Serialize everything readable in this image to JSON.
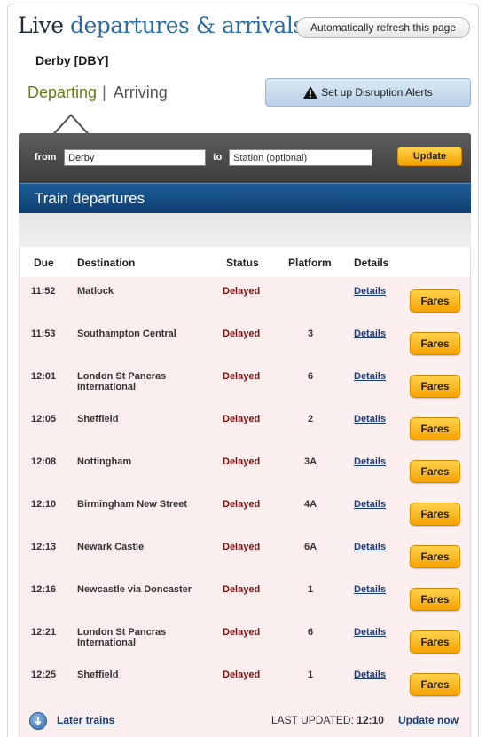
{
  "header": {
    "title_part1": "Live",
    "title_part2": "departures & arrivals",
    "refresh_label": "Automatically refresh this page"
  },
  "station": "Derby [DBY]",
  "tabs": {
    "departing": "Departing",
    "separator": "|",
    "arriving": "Arriving"
  },
  "alerts_label": "Set up Disruption Alerts",
  "search": {
    "from_label": "from",
    "from_value": "Derby",
    "to_label": "to",
    "to_placeholder": "Station (optional)",
    "update_label": "Update"
  },
  "panel_title": "Train departures",
  "columns": {
    "due": "Due",
    "destination": "Destination",
    "status": "Status",
    "platform": "Platform",
    "details": "Details"
  },
  "rows": [
    {
      "due": "11:52",
      "destination": "Matlock",
      "status": "Delayed",
      "platform": "",
      "details": "Details",
      "fares": "Fares"
    },
    {
      "due": "11:53",
      "destination": "Southampton Central",
      "status": "Delayed",
      "platform": "3",
      "details": "Details",
      "fares": "Fares"
    },
    {
      "due": "12:01",
      "destination": "London St Pancras International",
      "status": "Delayed",
      "platform": "6",
      "details": "Details",
      "fares": "Fares"
    },
    {
      "due": "12:05",
      "destination": "Sheffield",
      "status": "Delayed",
      "platform": "2",
      "details": "Details",
      "fares": "Fares"
    },
    {
      "due": "12:08",
      "destination": "Nottingham",
      "status": "Delayed",
      "platform": "3A",
      "details": "Details",
      "fares": "Fares"
    },
    {
      "due": "12:10",
      "destination": "Birmingham New Street",
      "status": "Delayed",
      "platform": "4A",
      "details": "Details",
      "fares": "Fares"
    },
    {
      "due": "12:13",
      "destination": "Newark Castle",
      "status": "Delayed",
      "platform": "6A",
      "details": "Details",
      "fares": "Fares"
    },
    {
      "due": "12:16",
      "destination": "Newcastle via Doncaster",
      "status": "Delayed",
      "platform": "1",
      "details": "Details",
      "fares": "Fares"
    },
    {
      "due": "12:21",
      "destination": "London St Pancras International",
      "status": "Delayed",
      "platform": "6",
      "details": "Details",
      "fares": "Fares"
    },
    {
      "due": "12:25",
      "destination": "Sheffield",
      "status": "Delayed",
      "platform": "1",
      "details": "Details",
      "fares": "Fares"
    }
  ],
  "footer": {
    "later_label": "Later trains",
    "last_updated_label": "LAST UPDATED:",
    "last_updated_time": "12:10",
    "update_now_label": "Update now"
  },
  "icons": {
    "alert": "warning-triangle-icon",
    "later": "arrow-down-circle-icon"
  },
  "colors": {
    "accent_blue": "#2e6da4",
    "status_delayed": "#7a1010",
    "button_orange": "#f5a300",
    "row_bg": "#fbeeee"
  }
}
